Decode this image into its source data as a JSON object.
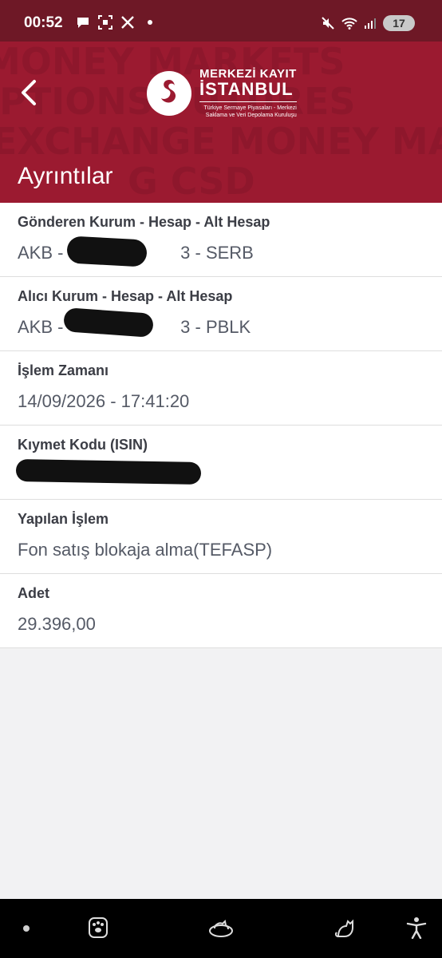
{
  "status_bar": {
    "time": "00:52",
    "battery": "17",
    "icons_left": [
      "chat-bubble-icon",
      "screenshot-icon",
      "x-logo-icon",
      "dot-icon"
    ],
    "icons_right": [
      "mute-icon",
      "wifi-icon",
      "signal-icon"
    ]
  },
  "header": {
    "logo_line1": "MERKEZİ KAYIT",
    "logo_line2": "İSTANBUL",
    "logo_sub1": "Türkiye Sermaye Piyasaları - Merkezi",
    "logo_sub2": "Saklama ve Veri Depolama Kuruluşu",
    "title": "Ayrıntılar",
    "bg_words": [
      "MONEY MARKETS",
      "OPTIONS FUTURES",
      "EXCHANGE MONEY MARKE",
      "G CSD"
    ],
    "brand_color": "#9b1a30"
  },
  "details": [
    {
      "label": "Gönderen Kurum - Hesap - Alt Hesap",
      "value": "AKB -                        3 - SERB"
    },
    {
      "label": "Alıcı Kurum - Hesap - Alt Hesap",
      "value": "AKB -                        3 - PBLK"
    },
    {
      "label": "İşlem Zamanı",
      "value": "14/09/2026 - 17:41:20"
    },
    {
      "label": "Kıymet Kodu (ISIN)",
      "value": ""
    },
    {
      "label": "Yapılan İşlem",
      "value": "Fon satış blokaja alma(TEFASP)"
    },
    {
      "label": "Adet",
      "value": "29.396,00"
    }
  ],
  "nav": {
    "icons": [
      "paw-icon",
      "cat-bed-icon",
      "cat-icon",
      "accessibility-icon"
    ]
  }
}
